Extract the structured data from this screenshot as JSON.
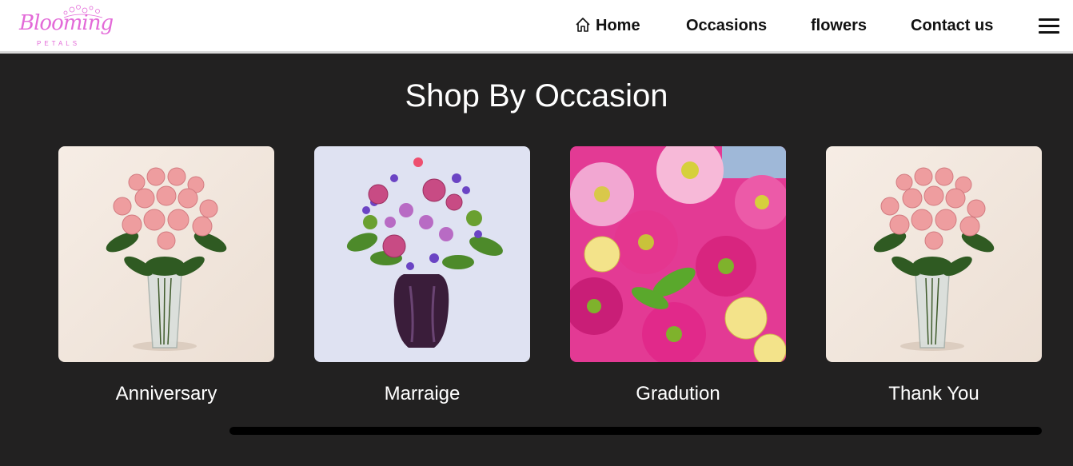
{
  "header": {
    "logo_text": "Blooming",
    "logo_subtext": "PETALS",
    "nav": {
      "home": "Home",
      "occasions": "Occasions",
      "flowers": "flowers",
      "contact": "Contact us"
    },
    "home_icon": "home-icon",
    "menu_icon": "hamburger-menu-icon"
  },
  "section": {
    "title": "Shop By Occasion",
    "cards": [
      {
        "label": "Anniversary",
        "image": "pink-roses-vase"
      },
      {
        "label": "Marraige",
        "image": "mixed-bouquet-purple-vase"
      },
      {
        "label": "Gradution",
        "image": "pink-daisies-yellow-roses"
      },
      {
        "label": "Thank You",
        "image": "pink-roses-vase"
      }
    ]
  },
  "colors": {
    "background": "#222121",
    "header": "#ffffff",
    "logo_pink": "#e36ad8",
    "text_light": "#ffffff",
    "scrollbar": "#000000"
  }
}
